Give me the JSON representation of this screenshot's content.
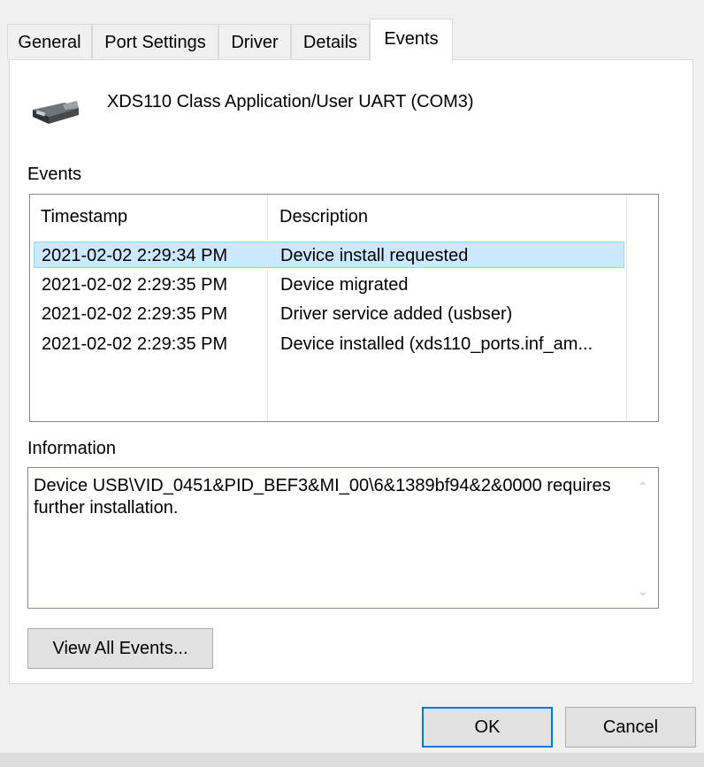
{
  "tabs": [
    {
      "label": "General",
      "active": false
    },
    {
      "label": "Port Settings",
      "active": false
    },
    {
      "label": "Driver",
      "active": false
    },
    {
      "label": "Details",
      "active": false
    },
    {
      "label": "Events",
      "active": true
    }
  ],
  "device": {
    "name": "XDS110 Class Application/User UART (COM3)",
    "icon": "serial-port-icon"
  },
  "events": {
    "label": "Events",
    "columns": [
      "Timestamp",
      "Description"
    ],
    "rows": [
      {
        "timestamp": "2021-02-02 2:29:34 PM",
        "description": "Device install requested",
        "selected": true
      },
      {
        "timestamp": "2021-02-02 2:29:35 PM",
        "description": "Device migrated",
        "selected": false
      },
      {
        "timestamp": "2021-02-02 2:29:35 PM",
        "description": "Driver service added (usbser)",
        "selected": false
      },
      {
        "timestamp": "2021-02-02 2:29:35 PM",
        "description": "Device installed (xds110_ports.inf_am...",
        "selected": false
      }
    ]
  },
  "information": {
    "label": "Information",
    "text": "Device USB\\VID_0451&PID_BEF3&MI_00\\6&1389bf94&2&0000 requires further installation."
  },
  "buttons": {
    "view_all": "View All Events...",
    "ok": "OK",
    "cancel": "Cancel"
  },
  "colors": {
    "selection": "#cce8ff",
    "selection_border": "#99d1ff",
    "default_button_border": "#0078d7"
  }
}
